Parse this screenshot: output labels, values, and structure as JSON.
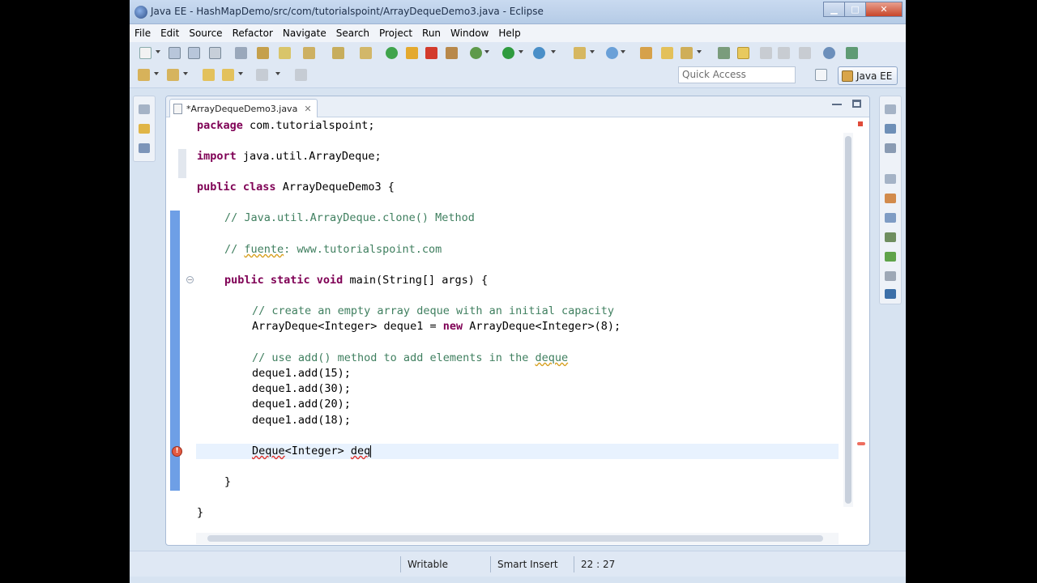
{
  "window": {
    "title": "Java EE - HashMapDemo/src/com/tutorialspoint/ArrayDequeDemo3.java - Eclipse"
  },
  "menu": {
    "items": [
      "File",
      "Edit",
      "Source",
      "Refactor",
      "Navigate",
      "Search",
      "Project",
      "Run",
      "Window",
      "Help"
    ]
  },
  "toolbar": {
    "quick_access_placeholder": "Quick Access",
    "perspective_label": "Java EE"
  },
  "editor": {
    "tab_label": "*ArrayDequeDemo3.java",
    "tab_close": "✕",
    "lines": [
      "package com.tutorialspoint;",
      "import java.util.ArrayDeque;",
      "public class ArrayDequeDemo3 {",
      "// Java.util.ArrayDeque.clone() Method",
      "// fuente: www.tutorialspoint.com",
      "public static void main(String[] args) {",
      "// create an empty array deque with an initial capacity",
      "ArrayDeque<Integer> deque1 = new ArrayDeque<Integer>(8);",
      "// use add() method to add elements in the deque",
      "deque1.add(15);",
      "deque1.add(30);",
      "deque1.add(20);",
      "deque1.add(18);",
      "Deque<Integer> deq",
      "}",
      "}"
    ]
  },
  "status": {
    "mode": "Writable",
    "insert": "Smart Insert",
    "position": "22 : 27"
  },
  "colors": {
    "keyword": "#7f0055",
    "comment": "#3f7f5f",
    "field": "#0000c0",
    "change_bar": "#6e9fe6",
    "current_line": "#e8f2fe",
    "error": "#e35a41"
  }
}
